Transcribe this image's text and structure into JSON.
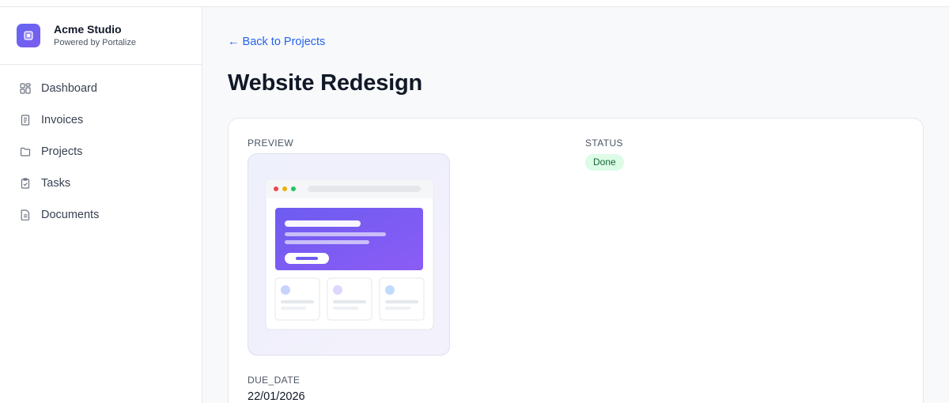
{
  "brand": {
    "name": "Acme Studio",
    "subtitle": "Powered by Portalize",
    "logo_icon": "app-logo-icon"
  },
  "sidebar": {
    "items": [
      {
        "label": "Dashboard",
        "icon": "dashboard-icon"
      },
      {
        "label": "Invoices",
        "icon": "invoice-icon"
      },
      {
        "label": "Projects",
        "icon": "folder-icon"
      },
      {
        "label": "Tasks",
        "icon": "clipboard-check-icon"
      },
      {
        "label": "Documents",
        "icon": "document-icon"
      }
    ]
  },
  "main": {
    "back_link": "← Back to Projects",
    "title": "Website Redesign",
    "fields": {
      "preview_label": "PREVIEW",
      "status_label": "STATUS",
      "status_value": "Done",
      "due_date_label": "DUE_DATE",
      "due_date_value": "22/01/2026"
    }
  },
  "colors": {
    "accent": "#6366f1",
    "link": "#2563eb",
    "status_done_bg": "#dcfce7",
    "status_done_text": "#166534"
  }
}
